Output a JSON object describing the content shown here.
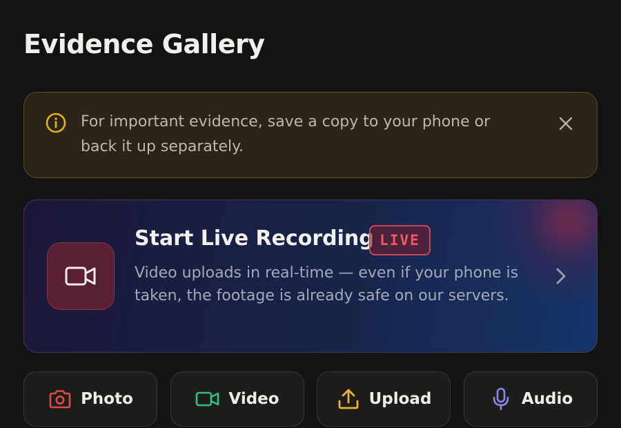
{
  "header": {
    "title": "Evidence Gallery"
  },
  "banner": {
    "icon": "info-icon",
    "text": "For important evidence, save a copy to your phone or back it up separately.",
    "close_icon": "close-icon",
    "accent": "#e0b31f"
  },
  "live_recording": {
    "icon": "video-camera-icon",
    "title": "Start Live Recording",
    "badge": "LIVE",
    "description": "Video uploads in real-time — even if your phone is taken, the footage is already safe on our servers.",
    "chevron_icon": "chevron-right-icon",
    "badge_color": "#ec5a63"
  },
  "actions": [
    {
      "label": "Photo",
      "icon": "camera-icon",
      "color": "#e0484a"
    },
    {
      "label": "Video",
      "icon": "video-camera-icon",
      "color": "#2fc08a"
    },
    {
      "label": "Upload",
      "icon": "upload-icon",
      "color": "#e9b23a"
    },
    {
      "label": "Audio",
      "icon": "microphone-icon",
      "color": "#8b88e8"
    }
  ]
}
